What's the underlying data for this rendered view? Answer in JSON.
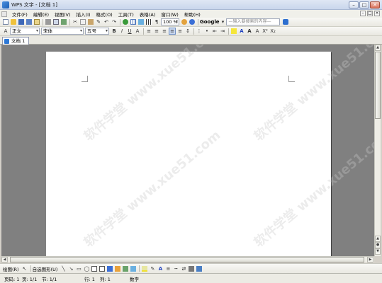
{
  "window": {
    "title": "WPS 文字 - [文档 1]",
    "minimize": "–",
    "maximize": "□",
    "close": "✕"
  },
  "menu": {
    "items": [
      "文件(F)",
      "编辑(E)",
      "视图(V)",
      "插入(I)",
      "格式(O)",
      "工具(T)",
      "表格(A)",
      "窗口(W)",
      "帮助(H)"
    ]
  },
  "toolbar1": {
    "zoom": "100 %",
    "google": "Google",
    "search_placeholder": "—输入要搜索的内容—"
  },
  "toolbar2": {
    "style": "正文",
    "font": "宋体",
    "size": "五号"
  },
  "tabs": {
    "doc": "文档 1"
  },
  "watermark": "软件学堂 www.xue51.com",
  "drawbar": {
    "draw": "绘图(R)",
    "autoshape": "自选图形(U)"
  },
  "status": {
    "page": "页码: 1",
    "pages": "页: 1/1",
    "section": "节: 1/1",
    "row": "行: 1",
    "col": "列: 1",
    "mode": "数字"
  }
}
